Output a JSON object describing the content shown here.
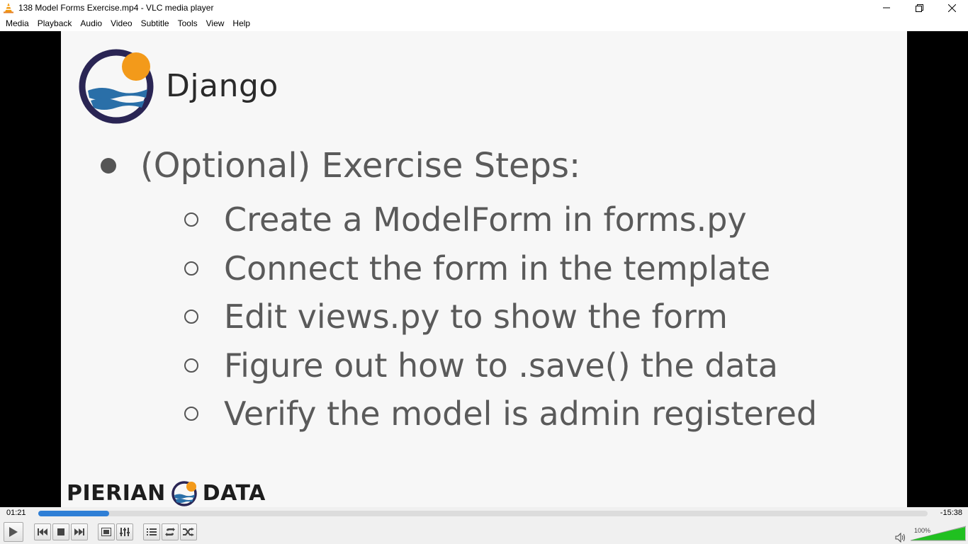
{
  "window": {
    "title": "138 Model Forms Exercise.mp4 - VLC media player"
  },
  "menu": {
    "items": [
      "Media",
      "Playback",
      "Audio",
      "Video",
      "Subtitle",
      "Tools",
      "View",
      "Help"
    ]
  },
  "slide": {
    "brand": "Django",
    "main_bullet": "(Optional) Exercise Steps:",
    "steps": [
      "Create a ModelForm in forms.py",
      "Connect the form in the template",
      "Edit views.py to show the form",
      "Figure out how to .save() the data",
      "Verify the model is admin registered"
    ],
    "footer_left": "PIERIAN",
    "footer_right": "DATA"
  },
  "player": {
    "elapsed": "01:21",
    "remaining": "-15:38",
    "progress_fraction": 0.08,
    "volume_label": "100%",
    "volume_fraction": 1.0,
    "accent_color": "#2f7fd6",
    "volume_color": "#20c020"
  },
  "icons": {
    "window_icon": "vlc-cone-icon",
    "minimize": "minimize-icon",
    "restore": "restore-icon",
    "close": "close-icon"
  }
}
